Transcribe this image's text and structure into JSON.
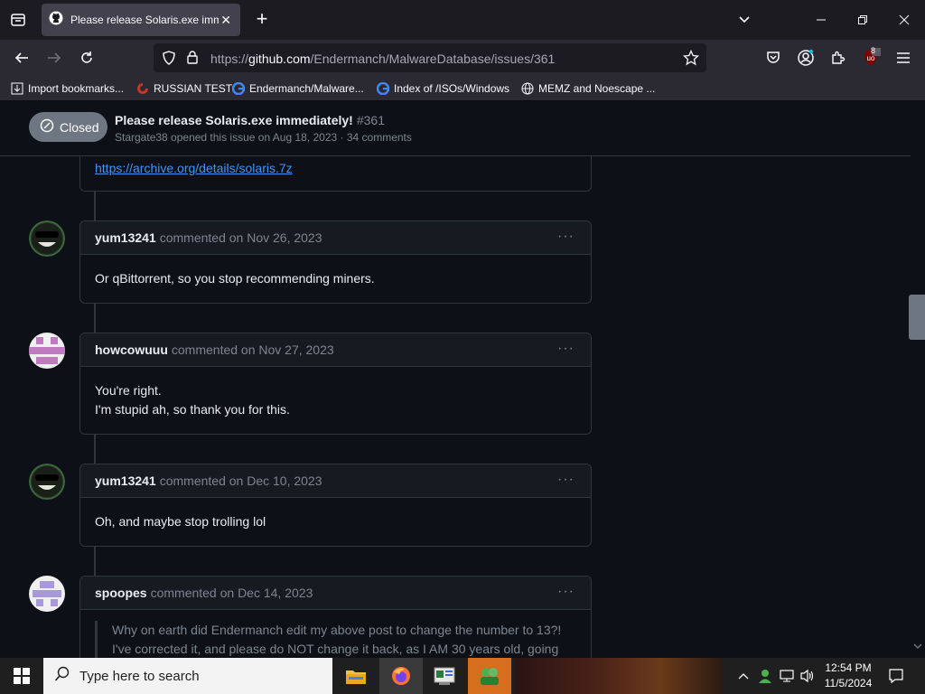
{
  "browser": {
    "tab_title": "Please release Solaris.exe imme",
    "url_host_prefix": "https://",
    "url_host": "github.com",
    "url_path": "/Endermanch/MalwareDatabase/issues/361",
    "extension_badge": "8"
  },
  "bookmarks": [
    {
      "label": "Import bookmarks...",
      "icon": "import-icon"
    },
    {
      "label": "RUSSIAN TEST",
      "icon": "site-icon"
    },
    {
      "label": "Endermanch/Malware...",
      "icon": "google-icon"
    },
    {
      "label": "Index of /ISOs/Windows",
      "icon": "google-icon"
    },
    {
      "label": "MEMZ and Noescape ...",
      "icon": "globe-icon"
    }
  ],
  "issue": {
    "state": "Closed",
    "title": "Please release Solaris.exe immediately!",
    "number": "#361",
    "meta": "Stargate38 opened this issue on Aug 18, 2023 · 34 comments"
  },
  "first_comment_link": "https://archive.org/details/solaris.7z",
  "comments": [
    {
      "author": "yum13241",
      "action": "commented on Nov 26, 2023",
      "body": [
        "Or qBittorrent, so you stop recommending miners."
      ]
    },
    {
      "author": "howcowuuu",
      "action": "commented on Nov 27, 2023",
      "body": [
        "You're right.",
        "I'm stupid ah, so thank you for this."
      ]
    },
    {
      "author": "yum13241",
      "action": "commented on Dec 10, 2023",
      "body": [
        "Oh, and maybe stop trolling lol"
      ]
    },
    {
      "author": "spoopes",
      "action": "commented on Dec 14, 2023",
      "quote": "Why on earth did Endermanch edit my above post to change the number to 13?! I've corrected it, and please do NOT change it back, as I AM 30 years old, going"
    }
  ],
  "more_label": "···",
  "taskbar": {
    "search_placeholder": "Type here to search",
    "time": "12:54 PM",
    "date": "11/5/2024"
  }
}
